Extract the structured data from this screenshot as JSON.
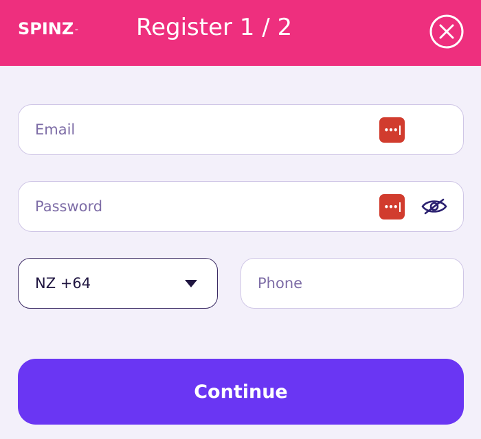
{
  "header": {
    "logo_text": "SPINZ",
    "logo_mark": "™",
    "title": "Register 1 / 2",
    "close_icon": "close-circle-icon"
  },
  "form": {
    "email": {
      "placeholder": "Email",
      "value": "",
      "password_manager_icon": "password-manager-icon"
    },
    "password": {
      "placeholder": "Password",
      "value": "",
      "password_manager_icon": "password-manager-icon",
      "visibility_icon": "eye-slash-icon"
    },
    "country_code": {
      "selected": "NZ +64",
      "icon": "caret-down-icon"
    },
    "phone": {
      "placeholder": "Phone",
      "value": ""
    },
    "continue_label": "Continue"
  },
  "colors": {
    "header_bg": "#ee2f7e",
    "page_bg": "#f3f0fa",
    "primary_button": "#6a36f3",
    "password_manager_badge": "#d13c2e",
    "placeholder_text": "#7d6ca6"
  }
}
